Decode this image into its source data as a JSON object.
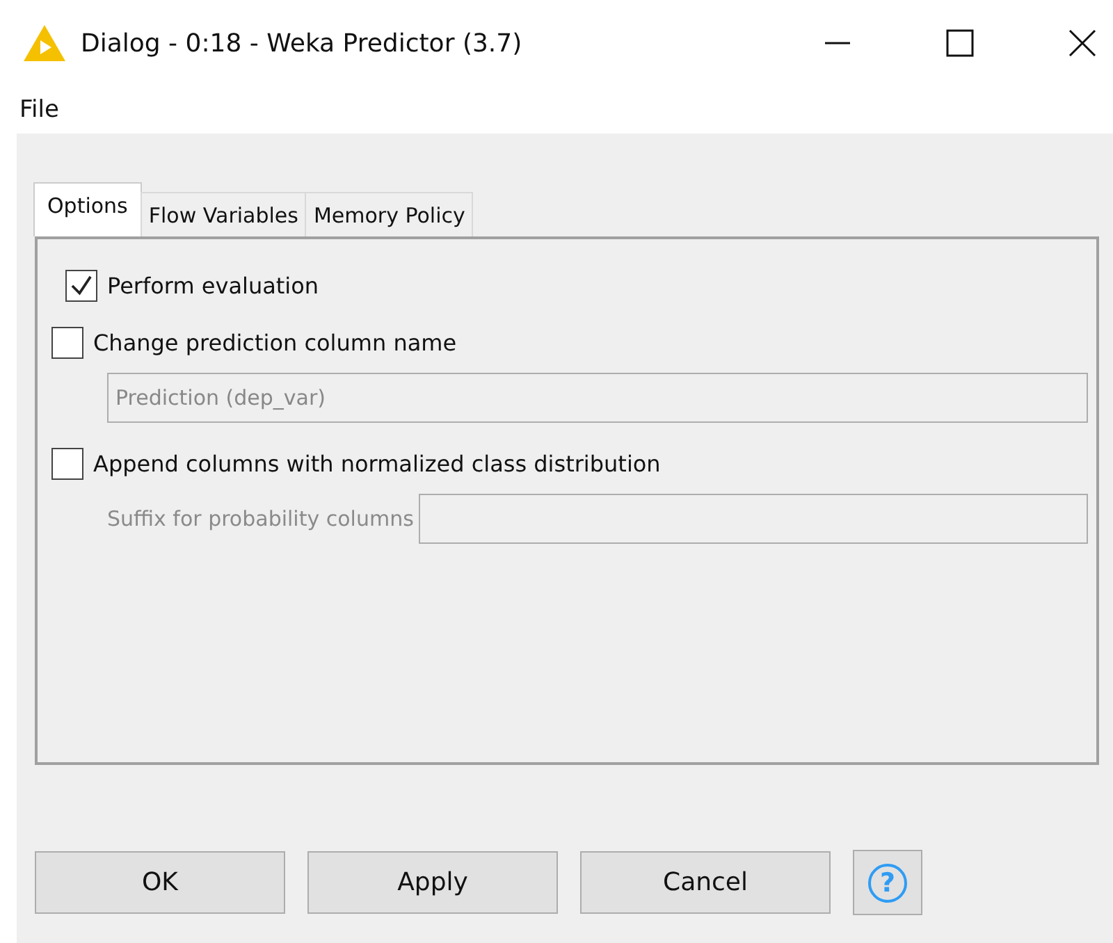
{
  "window": {
    "title": "Dialog - 0:18 - Weka Predictor (3.7)"
  },
  "menu": [
    {
      "label": "File"
    }
  ],
  "tabs": [
    {
      "label": "Options",
      "selected": true
    },
    {
      "label": "Flow Variables",
      "selected": false
    },
    {
      "label": "Memory Policy",
      "selected": false
    }
  ],
  "options": [
    {
      "kind": "checkbox",
      "label": "Perform evaluation",
      "checked": true,
      "indented": true
    },
    {
      "kind": "checkbox",
      "label": "Change prediction column name",
      "checked": false,
      "indented": false
    },
    {
      "kind": "field",
      "value": "Prediction (dep_var)",
      "disabled": true
    },
    {
      "kind": "checkbox",
      "label": "Append columns with normalized class distribution",
      "checked": false,
      "indented": false
    },
    {
      "kind": "labeled_field",
      "label": "Suffix for probability columns",
      "disabled": true
    }
  ],
  "buttons": [
    {
      "label": "OK"
    },
    {
      "label": "Apply"
    },
    {
      "label": "Cancel"
    }
  ],
  "help": {
    "label": "?"
  }
}
